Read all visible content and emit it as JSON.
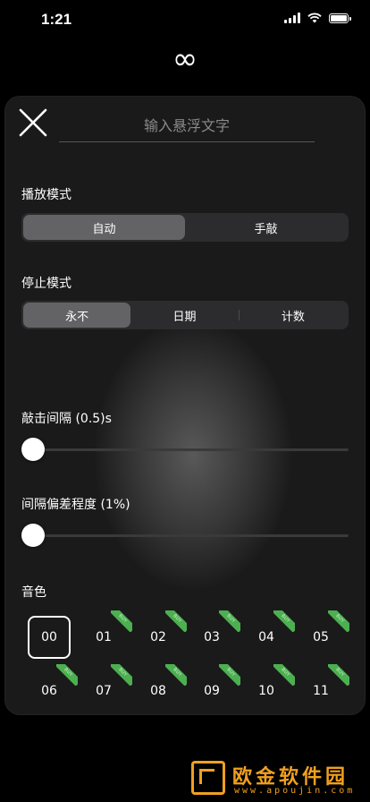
{
  "status_bar": {
    "time": "1:21"
  },
  "header": {
    "icon": "∞"
  },
  "panel": {
    "text_input": {
      "placeholder": "输入悬浮文字",
      "value": ""
    },
    "play_mode": {
      "label": "播放模式",
      "options": [
        "自动",
        "手敲"
      ],
      "selected": "自动"
    },
    "stop_mode": {
      "label": "停止模式",
      "options": [
        "永不",
        "日期",
        "计数"
      ],
      "selected": "永不"
    },
    "interval": {
      "label": "敲击间隔 (0.5)s",
      "value": 0.5
    },
    "deviation": {
      "label": "间隔偏差程度 (1%)",
      "value": 1
    },
    "sound": {
      "label": "音色",
      "selected": "00",
      "items": [
        {
          "id": "00",
          "badge": ""
        },
        {
          "id": "01",
          "badge": "BUY"
        },
        {
          "id": "02",
          "badge": "BUY"
        },
        {
          "id": "03",
          "badge": "BUY"
        },
        {
          "id": "04",
          "badge": "BUY"
        },
        {
          "id": "05",
          "badge": "BUY"
        },
        {
          "id": "06",
          "badge": "BUY"
        },
        {
          "id": "07",
          "badge": "BUY"
        },
        {
          "id": "08",
          "badge": "BUY"
        },
        {
          "id": "09",
          "badge": "BUY"
        },
        {
          "id": "10",
          "badge": "BUY"
        },
        {
          "id": "11",
          "badge": "BUY"
        }
      ]
    }
  },
  "watermark": {
    "title": "欧金软件园",
    "url": "www.apoujin.com"
  },
  "colors": {
    "background": "#000000",
    "panel": "#1a1a1a",
    "segment_active": "#636366",
    "badge": "#4caf50",
    "watermark": "#f0a020"
  }
}
